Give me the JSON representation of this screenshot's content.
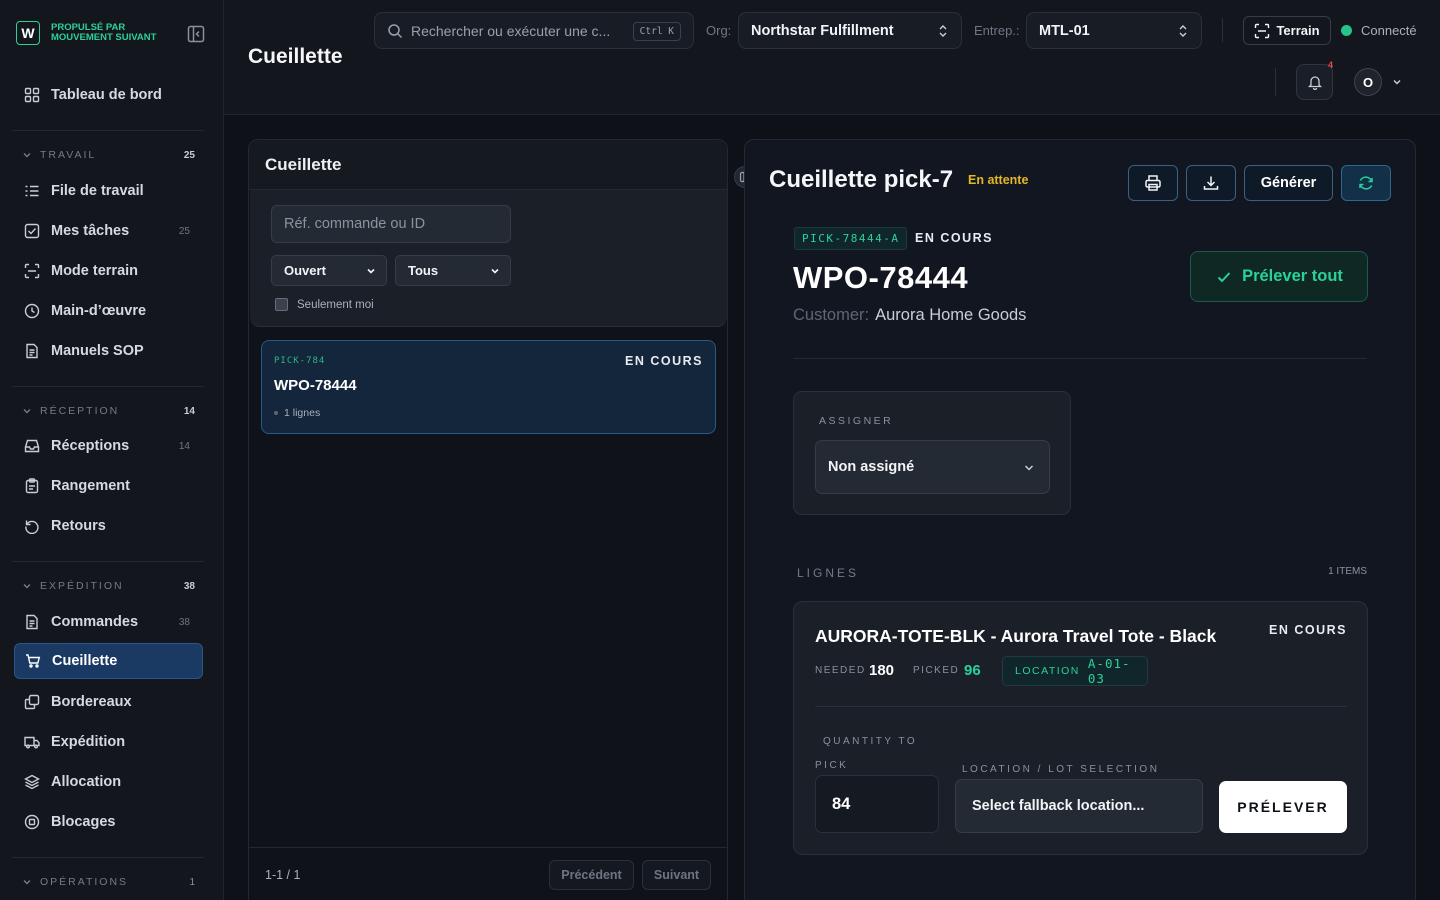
{
  "brand": {
    "logo_letter": "W",
    "line1": "PROPULSÉ PAR",
    "line2": "MOUVEMENT SUIVANT"
  },
  "sidebar": {
    "dashboard": "Tableau de bord",
    "sections": [
      {
        "title": "TRAVAIL",
        "count": "25",
        "items": [
          {
            "label": "File de travail",
            "icon": "list-icon"
          },
          {
            "label": "Mes tâches",
            "count": "25",
            "icon": "check-square-icon"
          },
          {
            "label": "Mode terrain",
            "icon": "scan-icon"
          },
          {
            "label": "Main-d’œuvre",
            "icon": "clock-icon"
          },
          {
            "label": "Manuels SOP",
            "icon": "document-icon"
          }
        ]
      },
      {
        "title": "RÉCEPTION",
        "count": "14",
        "items": [
          {
            "label": "Réceptions",
            "count": "14",
            "icon": "inbox-icon"
          },
          {
            "label": "Rangement",
            "icon": "clipboard-icon"
          },
          {
            "label": "Retours",
            "icon": "undo-icon"
          }
        ]
      },
      {
        "title": "EXPÉDITION",
        "count": "38",
        "items": [
          {
            "label": "Commandes",
            "count": "38",
            "icon": "document-icon"
          },
          {
            "label": "Cueillette",
            "icon": "cart-icon",
            "active": true
          },
          {
            "label": "Bordereaux",
            "icon": "copy-icon"
          },
          {
            "label": "Expédition",
            "icon": "truck-icon"
          },
          {
            "label": "Allocation",
            "icon": "layers-icon"
          },
          {
            "label": "Blocages",
            "icon": "block-icon"
          }
        ]
      },
      {
        "title": "OPÉRATIONS",
        "count": "1",
        "items": []
      }
    ]
  },
  "header": {
    "title": "Cueillette",
    "search_placeholder": "Rechercher ou exécuter une c...",
    "search_shortcut": "Ctrl K",
    "org_label": "Org:",
    "org_value": "Northstar Fulfillment",
    "warehouse_label": "Entrep.:",
    "warehouse_value": "MTL-01",
    "terrain_label": "Terrain",
    "status_label": "Connecté",
    "notif_count": "4",
    "avatar_letter": "O"
  },
  "list": {
    "title": "Cueillette",
    "search_placeholder": "Réf. commande ou ID",
    "status_filter": "Ouvert",
    "scope_filter": "Tous",
    "only_me_label": "Seulement moi",
    "items": [
      {
        "id": "PICK-784",
        "status": "EN COURS",
        "order": "WPO-78444",
        "lines": "1 lignes"
      }
    ],
    "pager": "1-1 / 1",
    "prev_label": "Précédent",
    "next_label": "Suivant"
  },
  "detail": {
    "title": "Cueillette pick-7",
    "status": "En attente",
    "generate_label": "Générer",
    "pick_code": "PICK-78444-A",
    "pick_status": "EN COURS",
    "order": "WPO-78444",
    "customer_label": "Customer:",
    "customer": "Aurora Home Goods",
    "pick_all_label": "Prélever tout",
    "assign_label": "ASSIGNER",
    "assign_value": "Non assigné",
    "lines_label": "LIGNES",
    "lines_count": "1 ITEMS",
    "line": {
      "title": "AURORA-TOTE-BLK - Aurora Travel Tote - Black",
      "status": "EN COURS",
      "needed_label": "NEEDED",
      "needed": "180",
      "picked_label": "PICKED",
      "picked": "96",
      "location_label": "LOCATION",
      "location": "A-01-03",
      "qty_label_1": "QUANTITY TO",
      "qty_label_2": "PICK",
      "qty_value": "84",
      "loc_sel_label": "LOCATION / LOT SELECTION",
      "loc_sel_value": "Select fallback location...",
      "pick_button": "PRÉLEVER"
    }
  },
  "colors": {
    "accent": "#2bd19a",
    "active_nav": "#1b3a63",
    "pending": "#e3b726",
    "danger": "#e04a4a"
  }
}
